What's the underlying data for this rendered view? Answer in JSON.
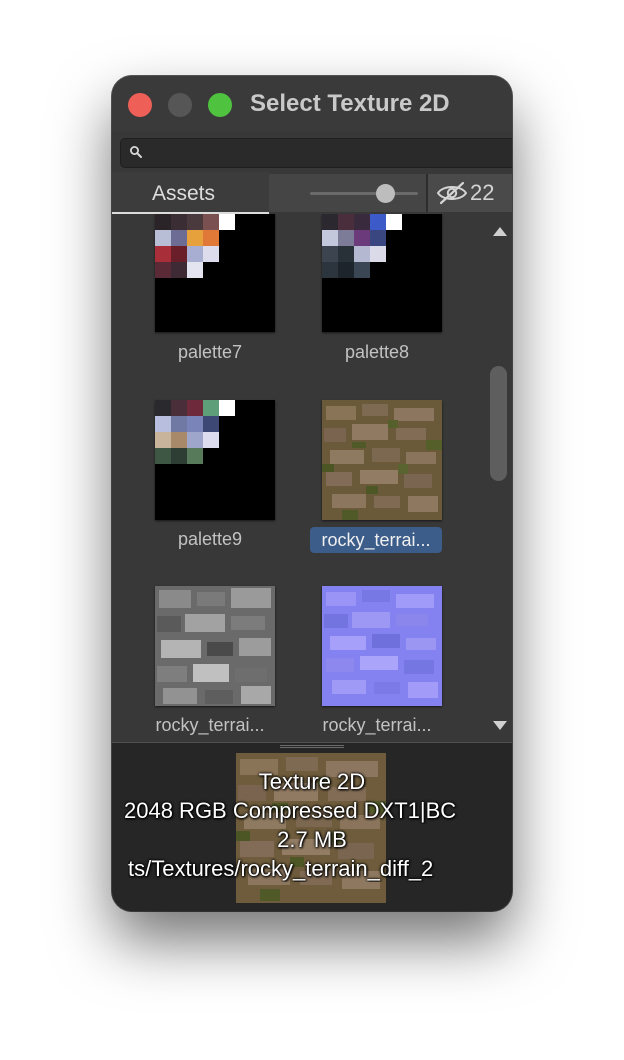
{
  "window": {
    "title": "Select Texture 2D"
  },
  "search": {
    "placeholder": ""
  },
  "toolbar": {
    "assets_tab_label": "Assets",
    "hidden_count": "22",
    "zoom_slider_level": 0.7
  },
  "assets": [
    {
      "label": "palette7",
      "kind": "palette",
      "selected": false
    },
    {
      "label": "palette8",
      "kind": "palette",
      "selected": false
    },
    {
      "label": "palette9",
      "kind": "palette",
      "selected": false
    },
    {
      "label": "rocky_terrai...",
      "kind": "diffuse",
      "selected": true
    },
    {
      "label": "rocky_terrai...",
      "kind": "roughness",
      "selected": false
    },
    {
      "label": "rocky_terrai...",
      "kind": "normal",
      "selected": false
    }
  ],
  "preview": {
    "type_label": "Texture 2D",
    "format_line": "2048  RGB Compressed DXT1|BC",
    "size_label": "2.7 MB",
    "path_line": "ts/Textures/rocky_terrain_diff_2"
  },
  "colors": {
    "accent_selection": "#3c5c89",
    "close": "#ed5f57",
    "maximize": "#4fc23f"
  },
  "icons": {
    "search": "magnifier",
    "visibility": "eye-slash",
    "scroll_up": "triangle-up",
    "scroll_down": "triangle-down"
  }
}
